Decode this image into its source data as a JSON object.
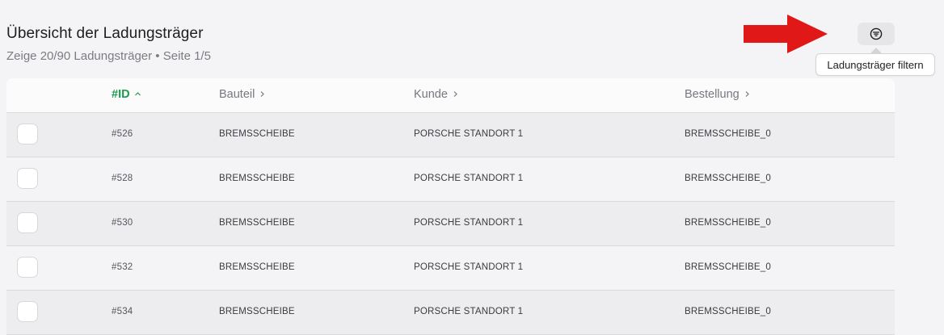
{
  "header": {
    "title": "Übersicht der Ladungsträger",
    "subtitle": "Zeige 20/90 Ladungsträger • Seite 1/5"
  },
  "filter": {
    "icon": "filter-icon",
    "tooltip": "Ladungsträger filtern"
  },
  "colors": {
    "accent": "#1f9b50",
    "arrow": "#e01818"
  },
  "table": {
    "columns": [
      {
        "label": "#ID",
        "chevron": "^",
        "sorted": true
      },
      {
        "label": "Bauteil",
        "chevron": ">"
      },
      {
        "label": "Kunde",
        "chevron": ">"
      },
      {
        "label": "Bestellung",
        "chevron": ">"
      }
    ],
    "rows": [
      {
        "id": "#526",
        "bauteil": "BREMSSCHEIBE",
        "kunde": "PORSCHE STANDORT 1",
        "bestellung": "BREMSSCHEIBE_0"
      },
      {
        "id": "#528",
        "bauteil": "BREMSSCHEIBE",
        "kunde": "PORSCHE STANDORT 1",
        "bestellung": "BREMSSCHEIBE_0"
      },
      {
        "id": "#530",
        "bauteil": "BREMSSCHEIBE",
        "kunde": "PORSCHE STANDORT 1",
        "bestellung": "BREMSSCHEIBE_0"
      },
      {
        "id": "#532",
        "bauteil": "BREMSSCHEIBE",
        "kunde": "PORSCHE STANDORT 1",
        "bestellung": "BREMSSCHEIBE_0"
      },
      {
        "id": "#534",
        "bauteil": "BREMSSCHEIBE",
        "kunde": "PORSCHE STANDORT 1",
        "bestellung": "BREMSSCHEIBE_0"
      }
    ]
  }
}
